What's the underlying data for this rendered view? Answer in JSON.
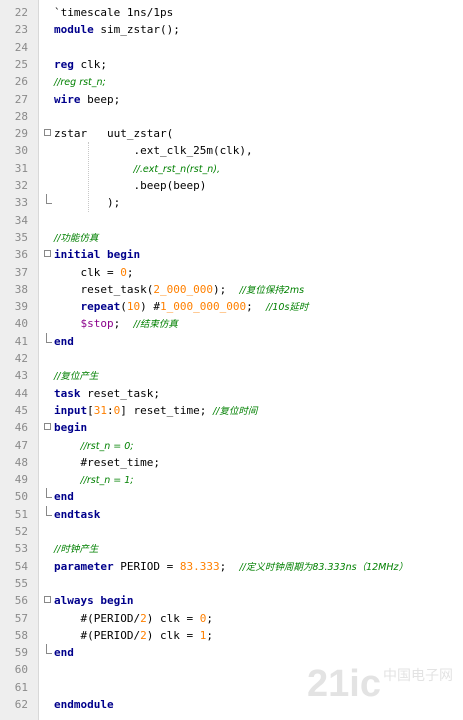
{
  "lines": [
    {
      "no": "22",
      "fold": "",
      "tokens": [
        {
          "t": "`timescale 1ns/1ps",
          "c": "plain"
        }
      ]
    },
    {
      "no": "23",
      "fold": "",
      "tokens": [
        {
          "t": "module",
          "c": "kw"
        },
        {
          "t": " sim_zstar();",
          "c": "plain"
        }
      ]
    },
    {
      "no": "24",
      "fold": "",
      "tokens": []
    },
    {
      "no": "25",
      "fold": "",
      "tokens": [
        {
          "t": "reg",
          "c": "kw"
        },
        {
          "t": " clk;",
          "c": "plain"
        }
      ]
    },
    {
      "no": "26",
      "fold": "",
      "tokens": [
        {
          "t": "//reg rst_n;",
          "c": "cm"
        }
      ]
    },
    {
      "no": "27",
      "fold": "",
      "tokens": [
        {
          "t": "wire",
          "c": "kw"
        },
        {
          "t": " beep;",
          "c": "plain"
        }
      ]
    },
    {
      "no": "28",
      "fold": "",
      "tokens": []
    },
    {
      "no": "29",
      "fold": "open",
      "tokens": [
        {
          "t": "zstar   uut_zstar(",
          "c": "plain"
        }
      ]
    },
    {
      "no": "30",
      "fold": "",
      "tokens": [
        {
          "t": "            .ext_clk_25m(clk),",
          "c": "plain"
        }
      ]
    },
    {
      "no": "31",
      "fold": "",
      "tokens": [
        {
          "t": "            ",
          "c": "plain"
        },
        {
          "t": "//.ext_rst_n(rst_n),",
          "c": "cm"
        }
      ]
    },
    {
      "no": "32",
      "fold": "",
      "tokens": [
        {
          "t": "            .beep(beep)",
          "c": "plain"
        }
      ]
    },
    {
      "no": "33",
      "fold": "end",
      "tokens": [
        {
          "t": "        );",
          "c": "plain"
        }
      ]
    },
    {
      "no": "34",
      "fold": "",
      "tokens": []
    },
    {
      "no": "35",
      "fold": "",
      "tokens": [
        {
          "t": "//功能仿真",
          "c": "cm"
        }
      ]
    },
    {
      "no": "36",
      "fold": "open",
      "tokens": [
        {
          "t": "initial begin",
          "c": "kw"
        }
      ]
    },
    {
      "no": "37",
      "fold": "",
      "tokens": [
        {
          "t": "    clk = ",
          "c": "plain"
        },
        {
          "t": "0",
          "c": "num"
        },
        {
          "t": ";",
          "c": "plain"
        }
      ]
    },
    {
      "no": "38",
      "fold": "",
      "tokens": [
        {
          "t": "    reset_task(",
          "c": "plain"
        },
        {
          "t": "2_000_000",
          "c": "num"
        },
        {
          "t": ");  ",
          "c": "plain"
        },
        {
          "t": "//复位保持2ms",
          "c": "cm"
        }
      ]
    },
    {
      "no": "39",
      "fold": "",
      "tokens": [
        {
          "t": "    ",
          "c": "plain"
        },
        {
          "t": "repeat",
          "c": "kw"
        },
        {
          "t": "(",
          "c": "plain"
        },
        {
          "t": "10",
          "c": "num"
        },
        {
          "t": ") #",
          "c": "plain"
        },
        {
          "t": "1_000_000_000",
          "c": "num"
        },
        {
          "t": ";  ",
          "c": "plain"
        },
        {
          "t": "//10s延时",
          "c": "cm"
        }
      ]
    },
    {
      "no": "40",
      "fold": "",
      "tokens": [
        {
          "t": "    ",
          "c": "plain"
        },
        {
          "t": "$stop",
          "c": "sys"
        },
        {
          "t": ";  ",
          "c": "plain"
        },
        {
          "t": "//结束仿真",
          "c": "cm"
        }
      ]
    },
    {
      "no": "41",
      "fold": "end",
      "tokens": [
        {
          "t": "end",
          "c": "kw"
        }
      ]
    },
    {
      "no": "42",
      "fold": "",
      "tokens": []
    },
    {
      "no": "43",
      "fold": "",
      "tokens": [
        {
          "t": "//复位产生",
          "c": "cm"
        }
      ]
    },
    {
      "no": "44",
      "fold": "",
      "tokens": [
        {
          "t": "task",
          "c": "kw"
        },
        {
          "t": " reset_task;",
          "c": "plain"
        }
      ]
    },
    {
      "no": "45",
      "fold": "",
      "tokens": [
        {
          "t": "input",
          "c": "kw"
        },
        {
          "t": "[",
          "c": "plain"
        },
        {
          "t": "31",
          "c": "num"
        },
        {
          "t": ":",
          "c": "plain"
        },
        {
          "t": "0",
          "c": "num"
        },
        {
          "t": "] reset_time; ",
          "c": "plain"
        },
        {
          "t": "//复位时间",
          "c": "cm"
        }
      ]
    },
    {
      "no": "46",
      "fold": "open",
      "tokens": [
        {
          "t": "begin",
          "c": "kw"
        }
      ]
    },
    {
      "no": "47",
      "fold": "",
      "tokens": [
        {
          "t": "    ",
          "c": "plain"
        },
        {
          "t": "//rst_n = 0;",
          "c": "cm"
        }
      ]
    },
    {
      "no": "48",
      "fold": "",
      "tokens": [
        {
          "t": "    #reset_time;",
          "c": "plain"
        }
      ]
    },
    {
      "no": "49",
      "fold": "",
      "tokens": [
        {
          "t": "    ",
          "c": "plain"
        },
        {
          "t": "//rst_n = 1;",
          "c": "cm"
        }
      ]
    },
    {
      "no": "50",
      "fold": "end",
      "tokens": [
        {
          "t": "end",
          "c": "kw"
        }
      ]
    },
    {
      "no": "51",
      "fold": "end",
      "tokens": [
        {
          "t": "endtask",
          "c": "kw"
        }
      ]
    },
    {
      "no": "52",
      "fold": "",
      "tokens": []
    },
    {
      "no": "53",
      "fold": "",
      "tokens": [
        {
          "t": "//时钟产生",
          "c": "cm"
        }
      ]
    },
    {
      "no": "54",
      "fold": "",
      "tokens": [
        {
          "t": "parameter",
          "c": "kw"
        },
        {
          "t": " PERIOD = ",
          "c": "plain"
        },
        {
          "t": "83.333",
          "c": "num"
        },
        {
          "t": ";  ",
          "c": "plain"
        },
        {
          "t": "//定义时钟周期为83.333ns（12MHz）",
          "c": "cm"
        }
      ]
    },
    {
      "no": "55",
      "fold": "",
      "tokens": []
    },
    {
      "no": "56",
      "fold": "open",
      "tokens": [
        {
          "t": "always begin",
          "c": "kw"
        }
      ]
    },
    {
      "no": "57",
      "fold": "",
      "tokens": [
        {
          "t": "    #(PERIOD/",
          "c": "plain"
        },
        {
          "t": "2",
          "c": "num"
        },
        {
          "t": ") clk = ",
          "c": "plain"
        },
        {
          "t": "0",
          "c": "num"
        },
        {
          "t": ";",
          "c": "plain"
        }
      ]
    },
    {
      "no": "58",
      "fold": "",
      "tokens": [
        {
          "t": "    #(PERIOD/",
          "c": "plain"
        },
        {
          "t": "2",
          "c": "num"
        },
        {
          "t": ") clk = ",
          "c": "plain"
        },
        {
          "t": "1",
          "c": "num"
        },
        {
          "t": ";",
          "c": "plain"
        }
      ]
    },
    {
      "no": "59",
      "fold": "end",
      "tokens": [
        {
          "t": "end",
          "c": "kw"
        }
      ]
    },
    {
      "no": "60",
      "fold": "",
      "tokens": []
    },
    {
      "no": "61",
      "fold": "",
      "tokens": []
    },
    {
      "no": "62",
      "fold": "",
      "tokens": [
        {
          "t": "endmodule",
          "c": "kw"
        }
      ]
    }
  ],
  "watermark": {
    "text": "21ic",
    "subtext": "中国电子网"
  },
  "colors": {
    "keyword": "#00008b",
    "comment": "#008000",
    "number": "#ff8000",
    "system": "#8b008b",
    "gutter": "#eeeeee",
    "lineno": "#8a8a8a"
  }
}
